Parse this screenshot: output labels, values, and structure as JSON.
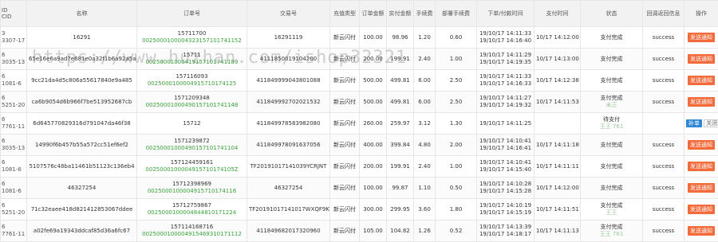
{
  "columns": [
    "ID\nCID",
    "名称",
    "订单号",
    "交易号",
    "充值类型",
    "订单金额",
    "实付金额",
    "手续费",
    "部署手续费",
    "下单/付款时间",
    "支付时间",
    "状态",
    "回调返回信息",
    "操作"
  ],
  "watermark": "https://www.huzhan.com/ishop32321",
  "rows": [
    {
      "id1": "3",
      "id2": "3307-17",
      "name": "16291",
      "order1": "15711700",
      "order2": "0025000100004323157101741152",
      "order1b": "9640",
      "trade": "16291119",
      "type": "新云闪付",
      "amount": "100.00",
      "paid": "98.96",
      "fee": "1.20",
      "dfee": "0.60",
      "t1": "19/10/17 14:11:33",
      "t2": "19/10/17 14:16:40",
      "paytime": "10/17 14:12:00",
      "status": "支付完成",
      "status2": "",
      "callback": "success",
      "op": "发送通知"
    },
    {
      "id1": "6",
      "id2": "3035-13",
      "name": "65e16e6a9ad7e681e0a32f1b6a92a5a0",
      "order1": "15711",
      "order2": "00250001000419157101741189",
      "order1b": "",
      "trade": "4111850019104200",
      "type": "新云闪付",
      "amount": "200.00",
      "paid": "199.91",
      "fee": "2.40",
      "dfee": "1.00",
      "t1": "19/10/17 14:11:29",
      "t2": "19/10/17 14:19:35",
      "paytime": "10/17 14:13:00",
      "status": "支付完成",
      "status2": "",
      "callback": "success",
      "op": "发送通知"
    },
    {
      "id1": "6",
      "id2": "1081-6",
      "name": "9cc21da4d5c806a55617840e9a485",
      "order1": "157116093",
      "order2": "0025000100004915710174125",
      "order1b": "457",
      "trade": "411849999043801088",
      "type": "新云闪付",
      "amount": "500.00",
      "paid": "499.81",
      "fee": "6.00",
      "dfee": "2.50",
      "t1": "19/10/17 14:11:33",
      "t2": "19/10/17 14:16:33",
      "paytime": "10/17 14:12:38",
      "status": "支付完成",
      "status2": "",
      "callback": "success",
      "op": "发送通知"
    },
    {
      "id1": "6",
      "id2": "5251-20",
      "name": "ca6b9054d6b966f7be513952687cb",
      "order1": "1571209348",
      "order2": "00250001000490157101741148",
      "order1b": "",
      "trade": "411849992702021532",
      "type": "新云闪付",
      "amount": "500.00",
      "paid": "499.81",
      "fee": "6.00",
      "dfee": "2.50",
      "t1": "19/10/17 14:11:27",
      "t2": "19/10/17 14:19:32",
      "paytime": "10/17 14:11:53",
      "status": "支付完成",
      "status2": "未正",
      "callback": "success",
      "op": "发送通知"
    },
    {
      "id1": "6",
      "id2": "7761-11",
      "name": "6d645770829316d791047da46f38",
      "order1": "15712",
      "order2": "",
      "order1b": "39267",
      "trade": "411849978583982080",
      "type": "新云闪付",
      "amount": "260.00",
      "paid": "259.97",
      "fee": "3.12",
      "dfee": "1.30",
      "t1": "19/10/17 14:11:25",
      "t2": "",
      "paytime": "",
      "status": "待支付",
      "status2": "王王 761",
      "callback": "",
      "op": "补单",
      "op2": "关闭"
    },
    {
      "id1": "6",
      "id2": "3035-13",
      "name": "14990f6b457b55a572cc51ef6ef2",
      "order1": "1571239872",
      "order2": "00250001000490157101741104",
      "order1b": "",
      "trade": "411849978091637056",
      "type": "新云闪付",
      "amount": "400.00",
      "paid": "399.84",
      "fee": "4.80",
      "dfee": "2.00",
      "t1": "19/10/17 14:10:41",
      "t2": "19/10/17 14:16:41",
      "paytime": "10/17 14:11:18",
      "status": "支付完成",
      "status2": "",
      "callback": "success",
      "op": "发送通知"
    },
    {
      "id1": "6",
      "id2": "1081-6",
      "name": "5107576c48ba11461b51123c136eb4",
      "order1": "157124459161",
      "order2": "0025000100004915710174105Z",
      "order1b": "",
      "trade": "TF20191017141039YCRJNT",
      "type": "新云闪付",
      "amount": "200.00",
      "paid": "199.91",
      "fee": "2.40",
      "dfee": "1.00",
      "t1": "19/10/17 14:10:41",
      "t2": "19/10/17 14:15:40",
      "paytime": "10/17 14:11:11",
      "status": "支付完成",
      "status2": "",
      "callback": "success",
      "op": "发送通知"
    },
    {
      "id1": "6",
      "id2": "1081-6",
      "name": "46327254",
      "order1": "15712398969",
      "order2": "0025000100004915710174116",
      "order1b": "",
      "trade": "46327254",
      "type": "新云闪付",
      "amount": "100.00",
      "paid": "99.87",
      "fee": "1.10",
      "dfee": "0.50",
      "t1": "19/10/17 14:10:28",
      "t2": "19/10/17 14:15:28",
      "paytime": "10/17 14:12:00",
      "status": "支付完成",
      "status2": "",
      "callback": "success",
      "op": "发送通知"
    },
    {
      "id1": "6",
      "id2": "5251-20",
      "name": "71c32eaee418d821412853067ddee",
      "order1": "15712759867",
      "order2": "0025000100004844810171224",
      "order1b": "",
      "trade": "TF20191017141017WXQF9K",
      "type": "新云闪付",
      "amount": "300.00",
      "paid": "299.95",
      "fee": "3.60",
      "dfee": "1.80",
      "t1": "19/10/17 14:10:19",
      "t2": "19/10/17 14:15:19",
      "paytime": "10/17 14:11:51",
      "status": "支付完成",
      "status2": "王王",
      "callback": "success",
      "op": "发送通知"
    },
    {
      "id1": "6",
      "id2": "7761-11",
      "name": "a02fe69a19343ddcaf85d36a6fc67",
      "order1": "157114168716",
      "order2": "0025000100004915469310171112",
      "order1b": "",
      "trade": "411849682017320960",
      "type": "新云闪付",
      "amount": "105.00",
      "paid": "104.82",
      "fee": "1.26",
      "dfee": "0.52",
      "t1": "19/10/17 14:13:39",
      "t2": "19/10/17 14:18:17",
      "paytime": "10/17 14:11:13",
      "status": "支付完成",
      "status2": "王王 761",
      "callback": "success",
      "op": "发送通知"
    }
  ]
}
